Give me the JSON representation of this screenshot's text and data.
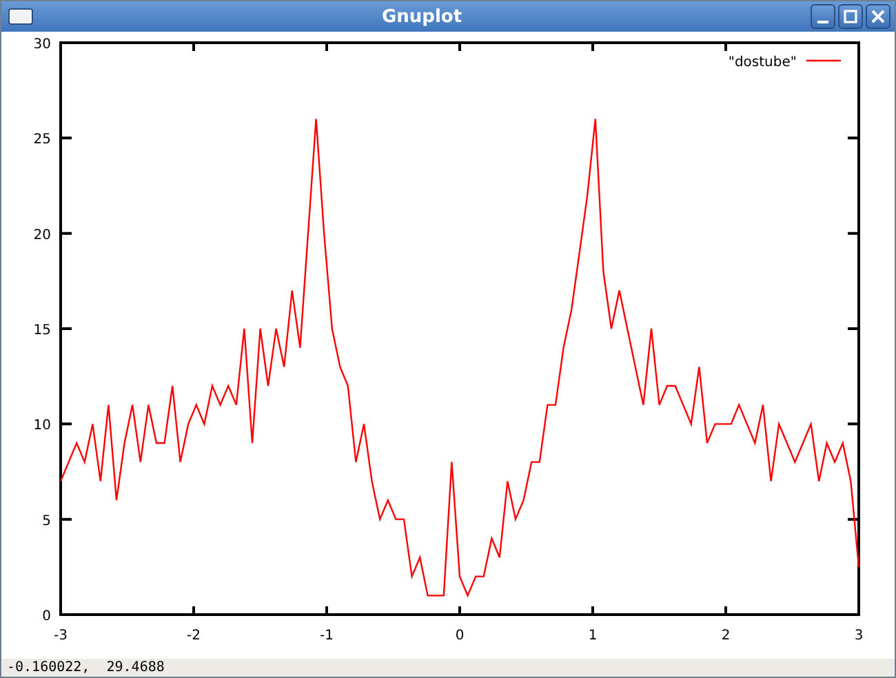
{
  "window": {
    "title": "Gnuplot"
  },
  "plot": {
    "chart_data": {
      "type": "line",
      "xlim": [
        -3,
        3
      ],
      "ylim": [
        0,
        30
      ],
      "xticks": [
        -3,
        -2,
        -1,
        0,
        1,
        2,
        3
      ],
      "yticks": [
        0,
        5,
        10,
        15,
        20,
        25,
        30
      ],
      "x": [
        -3,
        -2.94,
        -2.88,
        -2.82,
        -2.76,
        -2.7,
        -2.64,
        -2.58,
        -2.52,
        -2.46,
        -2.4,
        -2.34,
        -2.28,
        -2.22,
        -2.16,
        -2.1,
        -2.04,
        -1.98,
        -1.92,
        -1.86,
        -1.8,
        -1.74,
        -1.68,
        -1.62,
        -1.56,
        -1.5,
        -1.44,
        -1.38,
        -1.32,
        -1.26,
        -1.2,
        -1.14,
        -1.08,
        -1.02,
        -0.96,
        -0.9,
        -0.84,
        -0.78,
        -0.72,
        -0.66,
        -0.6,
        -0.54,
        -0.48,
        -0.42,
        -0.36,
        -0.3,
        -0.24,
        -0.18,
        -0.12,
        -0.06,
        0,
        0.06,
        0.12,
        0.18,
        0.24,
        0.3,
        0.36,
        0.42,
        0.48,
        0.54,
        0.6,
        0.66,
        0.72,
        0.78,
        0.84,
        0.9,
        0.96,
        1.02,
        1.08,
        1.14,
        1.2,
        1.26,
        1.32,
        1.38,
        1.44,
        1.5,
        1.56,
        1.62,
        1.68,
        1.74,
        1.8,
        1.86,
        1.92,
        1.98,
        2.04,
        2.1,
        2.16,
        2.22,
        2.28,
        2.34,
        2.4,
        2.46,
        2.52,
        2.58,
        2.64,
        2.7,
        2.76,
        2.82,
        2.88,
        2.94,
        3
      ],
      "series": [
        {
          "name": "\"dostube\"",
          "color": "#ff0000",
          "values": [
            7,
            8,
            9,
            8,
            10,
            7,
            11,
            6,
            9,
            11,
            8,
            11,
            9,
            9,
            12,
            8,
            10,
            11,
            10,
            12,
            11,
            12,
            11,
            15,
            9,
            15,
            12,
            15,
            13,
            17,
            14,
            20,
            26,
            20,
            15,
            13,
            12,
            8,
            10,
            7,
            5,
            6,
            5,
            5,
            2,
            3,
            1,
            1,
            1,
            8,
            2,
            1,
            2,
            2,
            4,
            3,
            7,
            5,
            6,
            8,
            8,
            11,
            11,
            14,
            16,
            19,
            22,
            26,
            18,
            15,
            17,
            15,
            13,
            11,
            15,
            11,
            12,
            12,
            11,
            10,
            13,
            9,
            10,
            10,
            10,
            11,
            10,
            9,
            11,
            7,
            10,
            9,
            8,
            9,
            10,
            7,
            9,
            8,
            9,
            7,
            2.5
          ]
        }
      ]
    }
  },
  "status_bar": {
    "text": "-0.160022,  29.4688"
  }
}
